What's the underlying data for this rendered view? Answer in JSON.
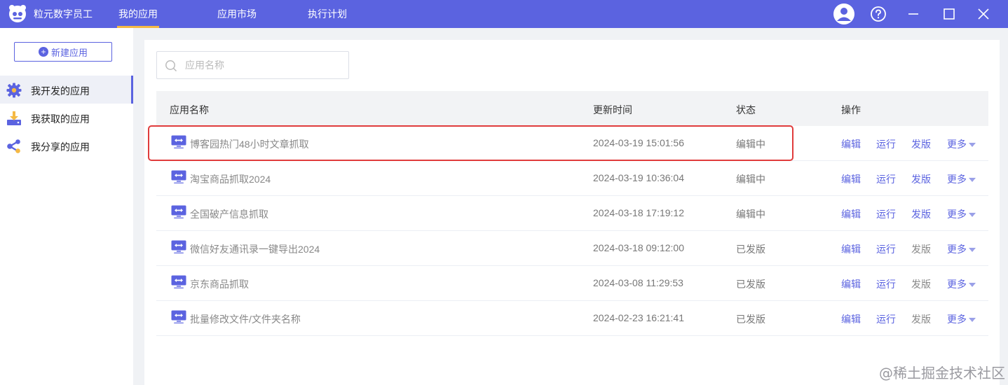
{
  "app": {
    "title": "粒元数字员工"
  },
  "nav": [
    {
      "label": "我的应用",
      "active": true
    },
    {
      "label": "应用市场",
      "active": false
    },
    {
      "label": "执行计划",
      "active": false
    }
  ],
  "window_controls": [
    "user-icon",
    "help-icon",
    "minimize-icon",
    "maximize-icon",
    "close-icon"
  ],
  "sidebar": {
    "new_app_label": "新建应用",
    "items": [
      {
        "label": "我开发的应用",
        "icon": "gear-icon",
        "active": true
      },
      {
        "label": "我获取的应用",
        "icon": "download-icon",
        "active": false
      },
      {
        "label": "我分享的应用",
        "icon": "share-icon",
        "active": false
      }
    ]
  },
  "search": {
    "placeholder": "应用名称"
  },
  "table": {
    "headers": {
      "name": "应用名称",
      "time": "更新时间",
      "status": "状态",
      "actions": "操作"
    },
    "action_labels": {
      "edit": "编辑",
      "run": "运行",
      "publish": "发版",
      "more": "更多"
    },
    "rows": [
      {
        "name": "博客园热门48小时文章抓取",
        "time": "2024-03-19 15:01:56",
        "status": "编辑中",
        "publish_enabled": true,
        "highlighted": true
      },
      {
        "name": "淘宝商品抓取2024",
        "time": "2024-03-19 10:36:04",
        "status": "编辑中",
        "publish_enabled": true
      },
      {
        "name": "全国破产信息抓取",
        "time": "2024-03-18 17:19:12",
        "status": "编辑中",
        "publish_enabled": true
      },
      {
        "name": "微信好友通讯录一键导出2024",
        "time": "2024-03-18 09:12:00",
        "status": "已发版",
        "publish_enabled": false
      },
      {
        "name": "京东商品抓取",
        "time": "2024-03-08 11:29:53",
        "status": "已发版",
        "publish_enabled": false
      },
      {
        "name": "批量修改文件/文件夹名称",
        "time": "2024-02-23 16:21:41",
        "status": "已发版",
        "publish_enabled": false
      }
    ]
  },
  "watermark": "@稀土掘金技术社区",
  "colors": {
    "brand": "#5b63e0",
    "nav_indicator": "#f5b944",
    "highlight": "#e03c3c"
  }
}
